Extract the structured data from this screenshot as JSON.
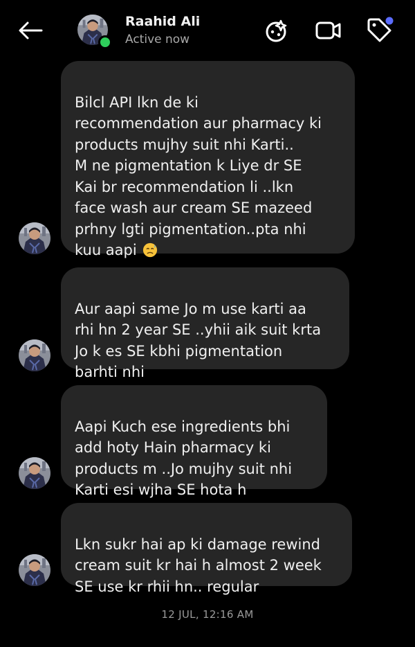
{
  "header": {
    "back_icon": "arrow-left-icon",
    "contact_name": "Raahid Ali",
    "status": "Active now",
    "actions": [
      {
        "icon": "effects-icon"
      },
      {
        "icon": "video-call-icon"
      },
      {
        "icon": "tag-icon",
        "has_badge": true
      }
    ],
    "online_color": "#2fcf5c",
    "badge_color": "#5b6cff"
  },
  "messages": [
    {
      "text": "Bilcl API lkn de ki\nrecommendation aur pharmacy ki\nproducts mujhy suit nhi Karti..\nM ne pigmentation k Liye dr SE\nKai br recommendation li ..lkn\nface wash aur cream SE mazeed\nprhny lgti pigmentation..pta nhi\nkuu aapi ",
      "emoji": "sad-sweat-face"
    },
    {
      "text": "Aur aapi same Jo m use karti aa\nrhi hn 2 year SE ..yhii aik suit krta\nJo k es SE kbhi pigmentation\nbarhti nhi"
    },
    {
      "text": "Aapi Kuch ese ingredients bhi\nadd hoty Hain pharmacy ki\nproducts m ..Jo mujhy suit nhi\nKarti esi wjha SE hota h"
    },
    {
      "text": "Lkn sukr hai ap ki damage rewind\ncream suit kr hai h almost 2 week\nSE use kr rhii hn.. regular"
    }
  ],
  "timestamp": "12 JUL, 12:16 AM",
  "colors": {
    "background": "#000000",
    "bubble": "#262626",
    "text": "#f0f0f0",
    "muted": "#a8a8a8"
  }
}
